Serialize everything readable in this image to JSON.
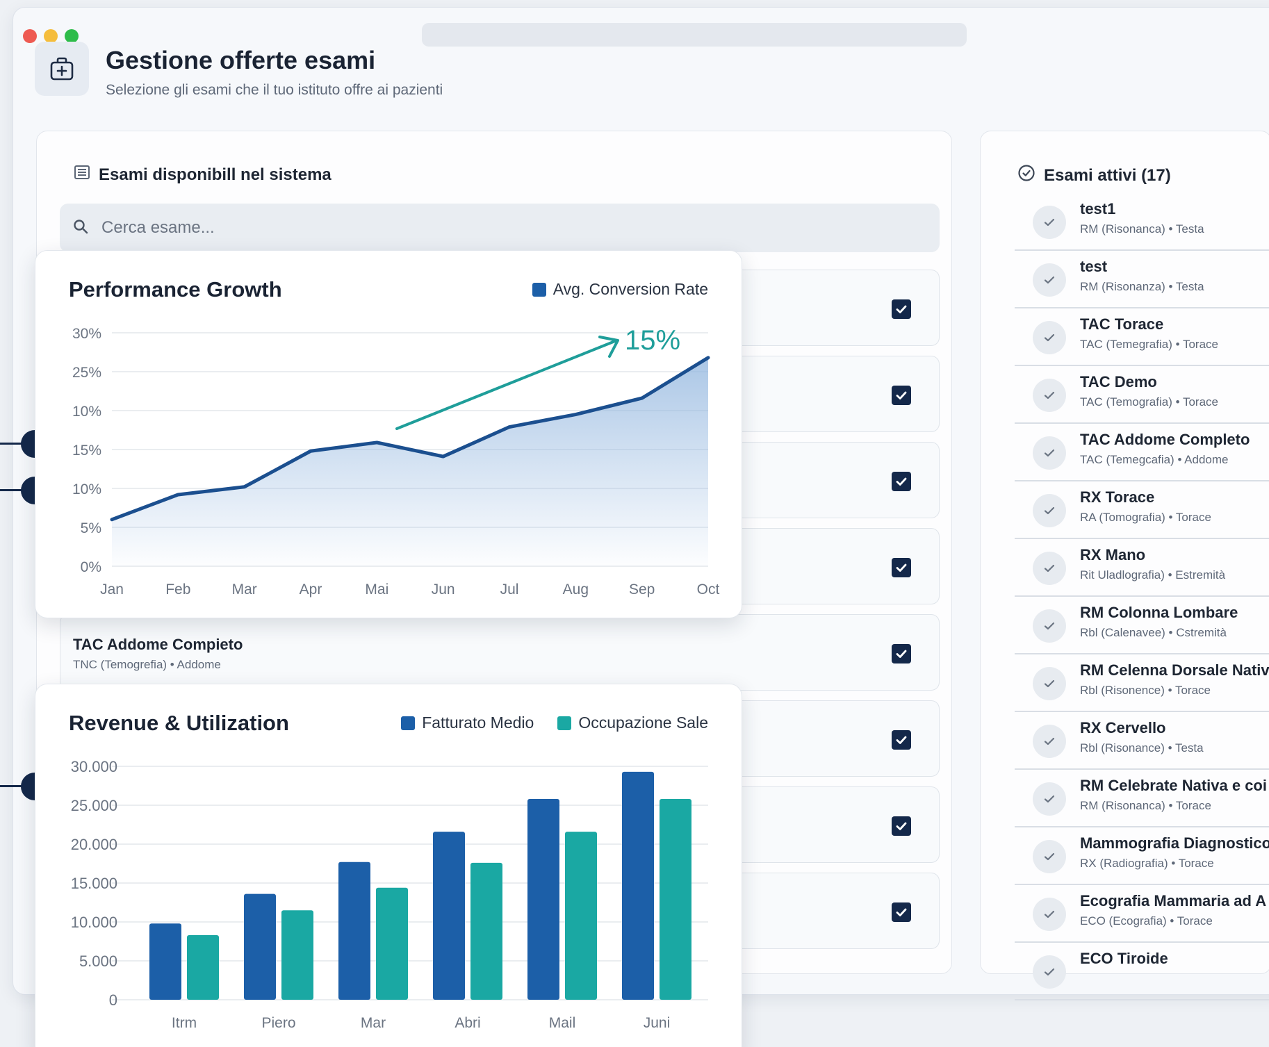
{
  "window": {
    "traffic_colors": [
      "#ee5a52",
      "#f5bd3c",
      "#2ebc4a"
    ]
  },
  "header": {
    "title": "Gestione offerte esami",
    "subtitle": "Selezione gli esami che il tuo istituto offre ai pazienti",
    "icon": "medical-briefcase-icon"
  },
  "available": {
    "heading": "Esami disponibill nel sistema",
    "heading_icon": "list-icon",
    "search_placeholder": "Cerca esame...",
    "search_icon": "search-icon",
    "rows": [
      {
        "name": "",
        "meta": "",
        "checked": true
      },
      {
        "name": "",
        "meta": "",
        "checked": true
      },
      {
        "name": "",
        "meta": "",
        "checked": true
      },
      {
        "name": "",
        "meta": "",
        "checked": true
      },
      {
        "name": "TAC Addome Compieto",
        "meta": "TNC (Temogrefia) • Addome",
        "checked": true
      },
      {
        "name": "",
        "meta": "",
        "checked": true
      },
      {
        "name": "",
        "meta": "",
        "checked": true
      },
      {
        "name": "",
        "meta": "",
        "checked": true
      }
    ]
  },
  "active": {
    "heading": "Esami attivi (17)",
    "heading_icon": "check-circle-icon",
    "items": [
      {
        "name": "test1",
        "meta": "RM (Risonanca) • Testa"
      },
      {
        "name": "test",
        "meta": "RM (Risonanza) • Testa"
      },
      {
        "name": "TAC Torace",
        "meta": "TAC (Temegrafia) • Torace"
      },
      {
        "name": "TAC Demo",
        "meta": "TAC (Temografia) • Torace"
      },
      {
        "name": "TAC Addome Completo",
        "meta": "TAC (Temegcafia) • Addome"
      },
      {
        "name": "RX Torace",
        "meta": "RA (Tomografia) • Torace"
      },
      {
        "name": "RX Mano",
        "meta": "Rit Uladlografia) • Estremità"
      },
      {
        "name": "RM Colonna Lombare",
        "meta": "Rbl (Calenavee) • Cstremità"
      },
      {
        "name": "RM Celenna Dorsale Nativ",
        "meta": "Rbl (Risonence) • Torace"
      },
      {
        "name": "RX Cervello",
        "meta": "Rbl (Risonance) • Testa"
      },
      {
        "name": "RM Celebrate Nativa e coi",
        "meta": "RM (Risonanca) • Torace"
      },
      {
        "name": "Mammografia Diagnostico",
        "meta": "RX (Radiografia) • Torace"
      },
      {
        "name": "Ecografia Mammaria ad A",
        "meta": "ECO (Ecografia) • Torace"
      },
      {
        "name": "ECO Tiroide",
        "meta": ""
      }
    ]
  },
  "chart_data": [
    {
      "type": "area",
      "title": "Performance Growth",
      "legend": [
        "Avg. Conversion Rate"
      ],
      "annotation": "15%",
      "colors": {
        "line": "#1b4f8f",
        "fill": "#8fb4de",
        "arrow": "#1f9e9a"
      },
      "categories": [
        "Jan",
        "Feb",
        "Mar",
        "Apr",
        "Mai",
        "Jun",
        "Jul",
        "Aug",
        "Sep",
        "Oct"
      ],
      "y_tick_labels": [
        "30%",
        "25%",
        "10%",
        "15%",
        "10%",
        "5%",
        "0%"
      ],
      "ylim": [
        0,
        30
      ],
      "series": [
        {
          "name": "Avg. Conversion Rate",
          "values": [
            6,
            9.2,
            10.2,
            14.8,
            15.9,
            14.1,
            17.9,
            19.5,
            21.6,
            26.8
          ]
        }
      ]
    },
    {
      "type": "bar",
      "title": "Revenue & Utilization",
      "categories": [
        "Itrm",
        "Piero",
        "Mar",
        "Abri",
        "Mail",
        "Juni"
      ],
      "y_tick_labels": [
        "30.000",
        "25.000",
        "20.000",
        "15.000",
        "10.000",
        "5.000",
        "0"
      ],
      "ylim": [
        0,
        30000
      ],
      "series": [
        {
          "name": "Fatturato Medio",
          "color": "#1c5fa8",
          "values": [
            9800,
            13600,
            17700,
            21600,
            25800,
            29300
          ]
        },
        {
          "name": "Occupazione Sale",
          "color": "#1aa8a3",
          "values": [
            8300,
            11500,
            14400,
            17600,
            21600,
            25800
          ]
        }
      ]
    }
  ]
}
